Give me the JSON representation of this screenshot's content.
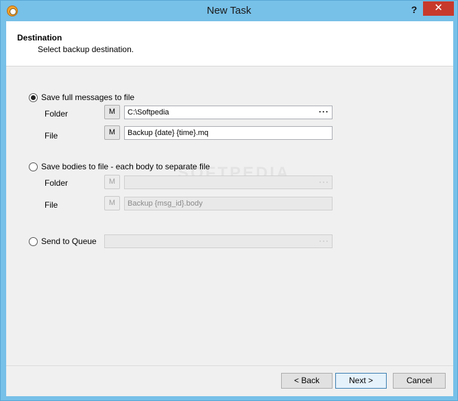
{
  "window": {
    "title": "New Task",
    "help_label": "?",
    "close_label": "✕"
  },
  "header": {
    "title": "Destination",
    "subtitle": "Select backup destination."
  },
  "full_messages": {
    "label": "Save full messages to file",
    "selected": true,
    "folder_label": "Folder",
    "folder_value": "C:\\Softpedia",
    "file_label": "File",
    "file_value": "Backup {date} {time}.mq",
    "macro_label": "M",
    "browse_label": "···"
  },
  "bodies": {
    "label": "Save bodies to file - each body to separate file",
    "selected": false,
    "folder_label": "Folder",
    "folder_value": "",
    "file_label": "File",
    "file_value": "Backup {msg_id}.body",
    "macro_label": "M",
    "browse_label": "···"
  },
  "queue": {
    "label": "Send to Queue",
    "selected": false,
    "value": "",
    "browse_label": "···"
  },
  "watermark": "SOFTPEDIA",
  "footer": {
    "back_label": "< Back",
    "next_label": "Next >",
    "cancel_label": "Cancel"
  }
}
